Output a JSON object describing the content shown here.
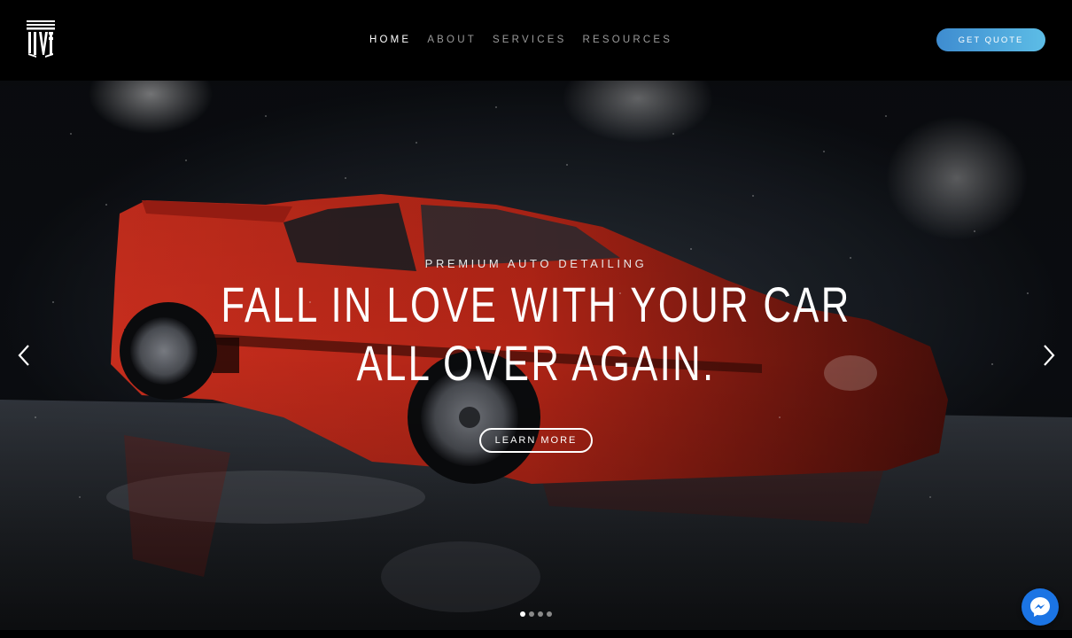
{
  "header": {
    "nav": [
      {
        "label": "HOME",
        "active": true
      },
      {
        "label": "ABOUT",
        "active": false
      },
      {
        "label": "SERVICES",
        "active": false
      },
      {
        "label": "RESOURCES",
        "active": false
      }
    ],
    "cta_label": "GET QUOTE",
    "logo_icon": "pillar-logo-icon"
  },
  "hero": {
    "eyebrow": "PREMIUM AUTO DETAILING",
    "headline_line1": "FALL IN LOVE WITH YOUR CAR",
    "headline_line2": "ALL OVER AGAIN.",
    "button_label": "LEARN MORE",
    "prev_icon": "chevron-left-icon",
    "next_icon": "chevron-right-icon",
    "slide_count": 4,
    "active_slide": 1
  },
  "chat": {
    "icon": "messenger-icon"
  },
  "colors": {
    "accent_start": "#3e8cd0",
    "accent_end": "#5dbde6",
    "car_red": "#c8261a",
    "messenger_blue": "#1b74e4"
  }
}
